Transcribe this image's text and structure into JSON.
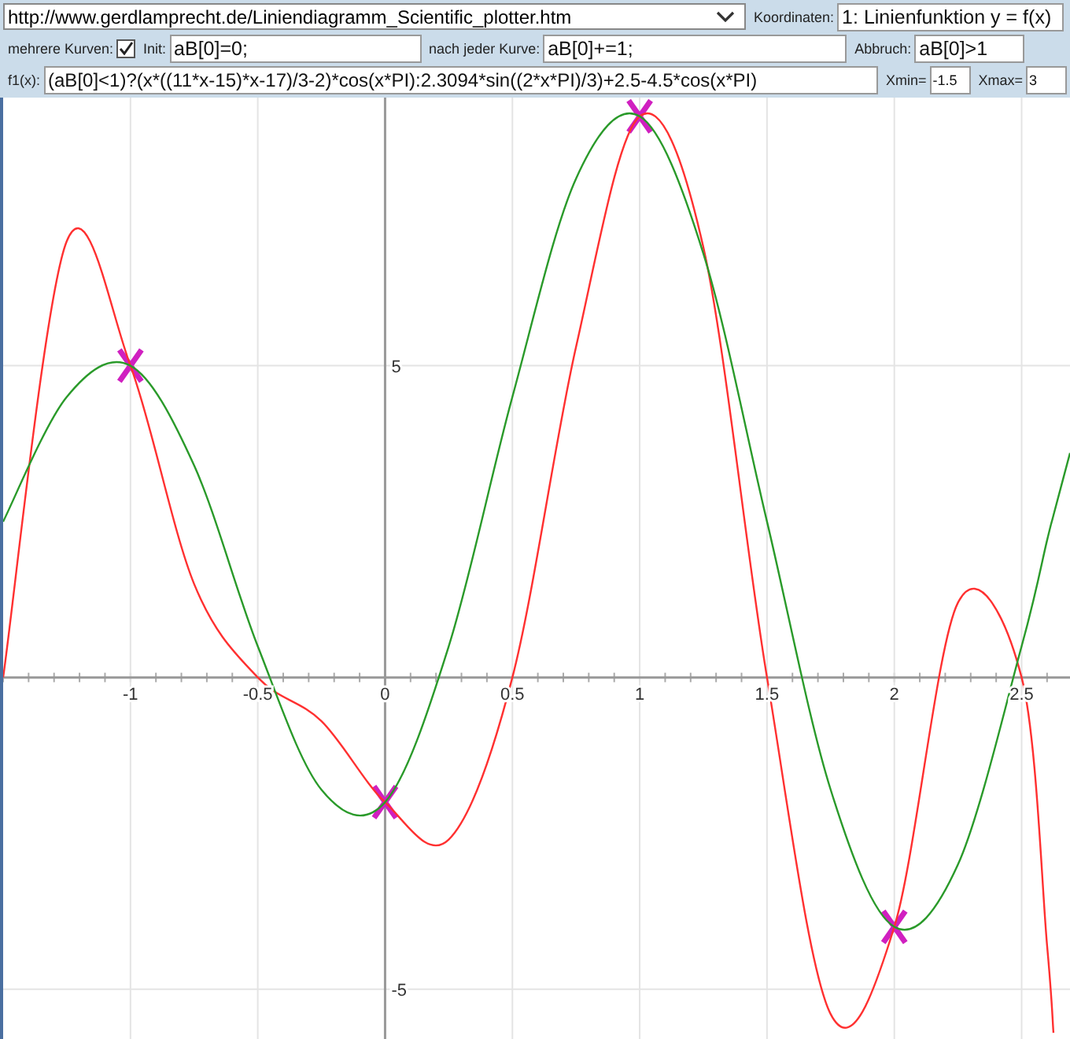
{
  "toolbar": {
    "url": "http://www.gerdlamprecht.de/Liniendiagramm_Scientific_plotter.htm",
    "coord_label": "Koordinaten:",
    "coord_value": "1: Linienfunktion y = f(x)"
  },
  "options": {
    "multi_label": "mehrere Kurven:",
    "multi_checked": true,
    "init_label": "Init:",
    "init_value": "aB[0]=0;",
    "after_label": "nach jeder Kurve:",
    "after_value": "aB[0]+=1;",
    "stop_label": "Abbruch:",
    "stop_value": "aB[0]>1"
  },
  "formula": {
    "label": "f1(x):",
    "value": "(aB[0]<1)?(x*((11*x-15)*x-17)/3-2)*cos(x*PI):2.3094*sin((2*x*PI)/3)+2.5-4.5*cos(x*PI)",
    "xmin_label": "Xmin=",
    "xmin_value": "-1.5",
    "xmax_label": "Xmax=",
    "xmax_value": "3"
  },
  "plot": {
    "chart_data": {
      "type": "line",
      "x": [
        -1.5,
        -1.25,
        -1,
        -0.75,
        -0.5,
        -0.25,
        0,
        0.25,
        0.5,
        0.75,
        1,
        1.25,
        1.5,
        1.75,
        2,
        2.25,
        2.5,
        2.6,
        2.625,
        2.69
      ],
      "series": [
        {
          "color": "#ff3030",
          "values": [
            0,
            7.0,
            5,
            1.5,
            0,
            -0.7,
            -2,
            -2.6,
            0,
            5.3,
            9,
            6.9,
            0,
            -5.4,
            -4,
            1.2,
            0,
            -4.3,
            -5.7,
            null
          ]
        },
        {
          "color": "#2a9a2a",
          "values": [
            2.5,
            4.5,
            5,
            3.4,
            0.5,
            -1.8,
            -2,
            0.5,
            4.5,
            8,
            9,
            6.8,
            2.5,
            -1.8,
            -4,
            -3,
            0.5,
            2.2,
            2.6,
            3.6
          ]
        },
        {
          "marker": "x",
          "color": "#d020c0",
          "values": [
            null,
            null,
            5,
            null,
            null,
            null,
            -2,
            null,
            null,
            null,
            9,
            null,
            null,
            null,
            -4,
            null,
            null,
            null,
            null,
            null
          ]
        }
      ],
      "grid": true,
      "xlim": [
        -1.5,
        2.69
      ],
      "ylim": [
        -5.9,
        9.3
      ],
      "xticks": [
        {
          "value": -1,
          "label": "-1"
        },
        {
          "value": -0.5,
          "label": "-0.5"
        },
        {
          "value": 0,
          "label": "0"
        },
        {
          "value": 0.5,
          "label": "0.5"
        },
        {
          "value": 1,
          "label": "1"
        },
        {
          "value": 1.5,
          "label": "1.5"
        },
        {
          "value": 2,
          "label": "2"
        },
        {
          "value": 2.5,
          "label": "2.5"
        }
      ],
      "yticks": [
        {
          "value": 5,
          "label": "5"
        },
        {
          "value": -5,
          "label": "-5"
        }
      ]
    }
  }
}
